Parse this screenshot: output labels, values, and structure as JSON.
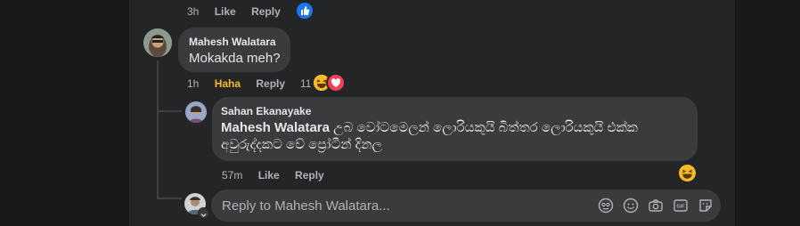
{
  "top_actions": {
    "time": "3h",
    "like": "Like",
    "reply": "Reply"
  },
  "comment": {
    "author": "Mahesh Walatara",
    "text": "Mokakda meh?",
    "time": "1h",
    "reaction_label": "Haha",
    "reply": "Reply",
    "reaction_count": "11"
  },
  "reply": {
    "author": "Sahan Ekanayake",
    "mention": "Mahesh Walatara",
    "text_line1": " උබ වෝටමෙලන් ලොරියකුයි බිත්තර ලොරියකුයි එක්ක",
    "text_line2": "අවුරුද්දකට වේ ප්‍රෝටීන් දිනල",
    "time": "57m",
    "like": "Like",
    "reply": "Reply"
  },
  "composer": {
    "placeholder": "Reply to Mahesh Walatara..."
  },
  "colors": {
    "haha": "#f7b928",
    "like_blue": "#1877f2",
    "love_red": "#f33e58"
  }
}
